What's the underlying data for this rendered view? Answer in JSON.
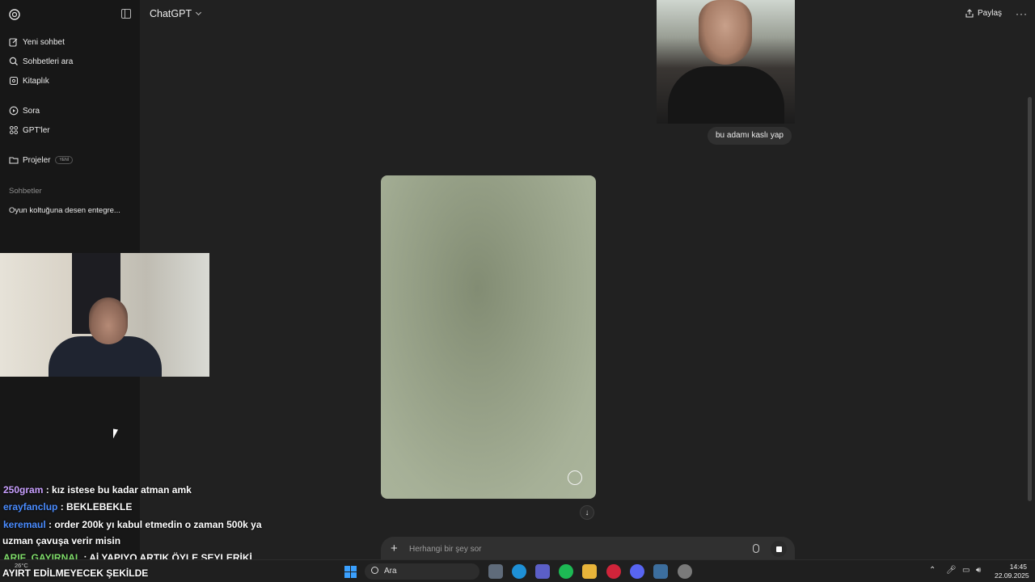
{
  "header": {
    "model": "ChatGPT",
    "share_label": "Paylaş",
    "more_label": "···"
  },
  "sidebar": {
    "items": [
      {
        "label": "Yeni sohbet",
        "icon": "edit-icon"
      },
      {
        "label": "Sohbetleri ara",
        "icon": "search-icon"
      },
      {
        "label": "Kitaplık",
        "icon": "library-icon"
      },
      {
        "label": "Sora",
        "icon": "play-icon"
      },
      {
        "label": "GPT'ler",
        "icon": "grid-icon"
      },
      {
        "label": "Projeler",
        "icon": "folder-icon",
        "badge": "YENİ"
      }
    ],
    "section_title": "Sohbetler",
    "chats": [
      "Oyun koltuğuna desen entegre..."
    ]
  },
  "conversation": {
    "user_message": "bu adamı kaslı yap"
  },
  "composer": {
    "placeholder": "Herhangi bir şey sor"
  },
  "stream_chat": [
    {
      "user": "250gram",
      "color": "#c9a0ff",
      "text": " : kız istese bu kadar atman amk"
    },
    {
      "user": "erayfanclup",
      "color": "#4a8cff",
      "text": " : BEKLEBEKLE"
    },
    {
      "user": "keremaul",
      "color": "#4a8cff",
      "text": " : order 200k yı kabul etmedin o zaman 500k ya"
    },
    {
      "user": "",
      "color": "#ffffff",
      "text": "uzman çavuşa verir misin"
    },
    {
      "user": "ARIF_GAYIRNAL",
      "color": "#7fdc6a",
      "text": " : Aİ YAPIYO ARTIK ÖYLE ŞEYLERİKİ"
    },
    {
      "user": "",
      "color": "#ffffff",
      "text": "AYIRT EDİLMEYECEK ŞEKİLDE"
    }
  ],
  "taskbar": {
    "search_placeholder": "Ara",
    "weather": "26°C",
    "time": "14:45",
    "date": "22.09.2025"
  }
}
